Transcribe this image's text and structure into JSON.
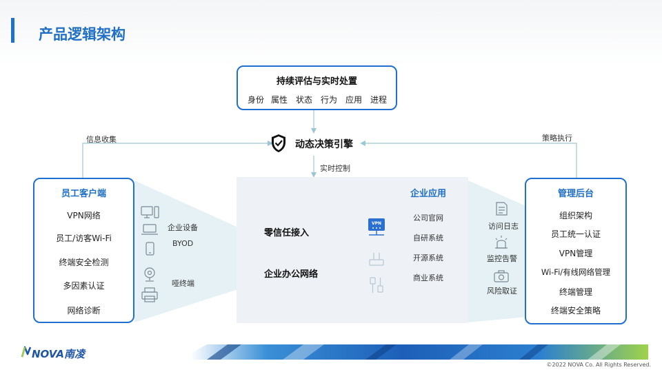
{
  "title": "产品逻辑架构",
  "top_box": {
    "title": "持续评估与实时处置",
    "items": [
      "身份",
      "属性",
      "状态",
      "行为",
      "应用",
      "进程"
    ]
  },
  "engine": {
    "label": "动态决策引擎",
    "icon": "shield-check-icon"
  },
  "arrows": {
    "info_collect": "信息收集",
    "policy_exec": "策略执行",
    "realtime_control": "实时控制"
  },
  "left_box": {
    "title": "员工客户端",
    "items": [
      "VPN网络",
      "员工/访客Wi-Fi",
      "终端安全检测",
      "多因素认证",
      "网络诊断"
    ]
  },
  "devices": {
    "enterprise_label": "企业设备",
    "byod_label": "BYOD",
    "dumb_label": "哑终端"
  },
  "center": {
    "zero_trust": "零信任接入",
    "office_net": "企业办公网络",
    "apps_title": "企业应用",
    "apps": [
      "公司官网",
      "自研系统",
      "开源系统",
      "商业系统"
    ]
  },
  "right_labels": [
    "访问日志",
    "监控告警",
    "风险取证"
  ],
  "right_box": {
    "title": "管理后台",
    "items": [
      "组织架构",
      "员工统一认证",
      "VPN管理",
      "Wi-Fi/有线网络管理",
      "终端管理",
      "终端安全策略"
    ]
  },
  "footer": {
    "logo_text": "NOVA南凌",
    "copyright": "©2022  NOVA  Co.  All  Rights  Reserved."
  },
  "colors": {
    "accent": "#1e6fd0",
    "title": "#1f6fc5",
    "panel": "#eef2f6"
  }
}
